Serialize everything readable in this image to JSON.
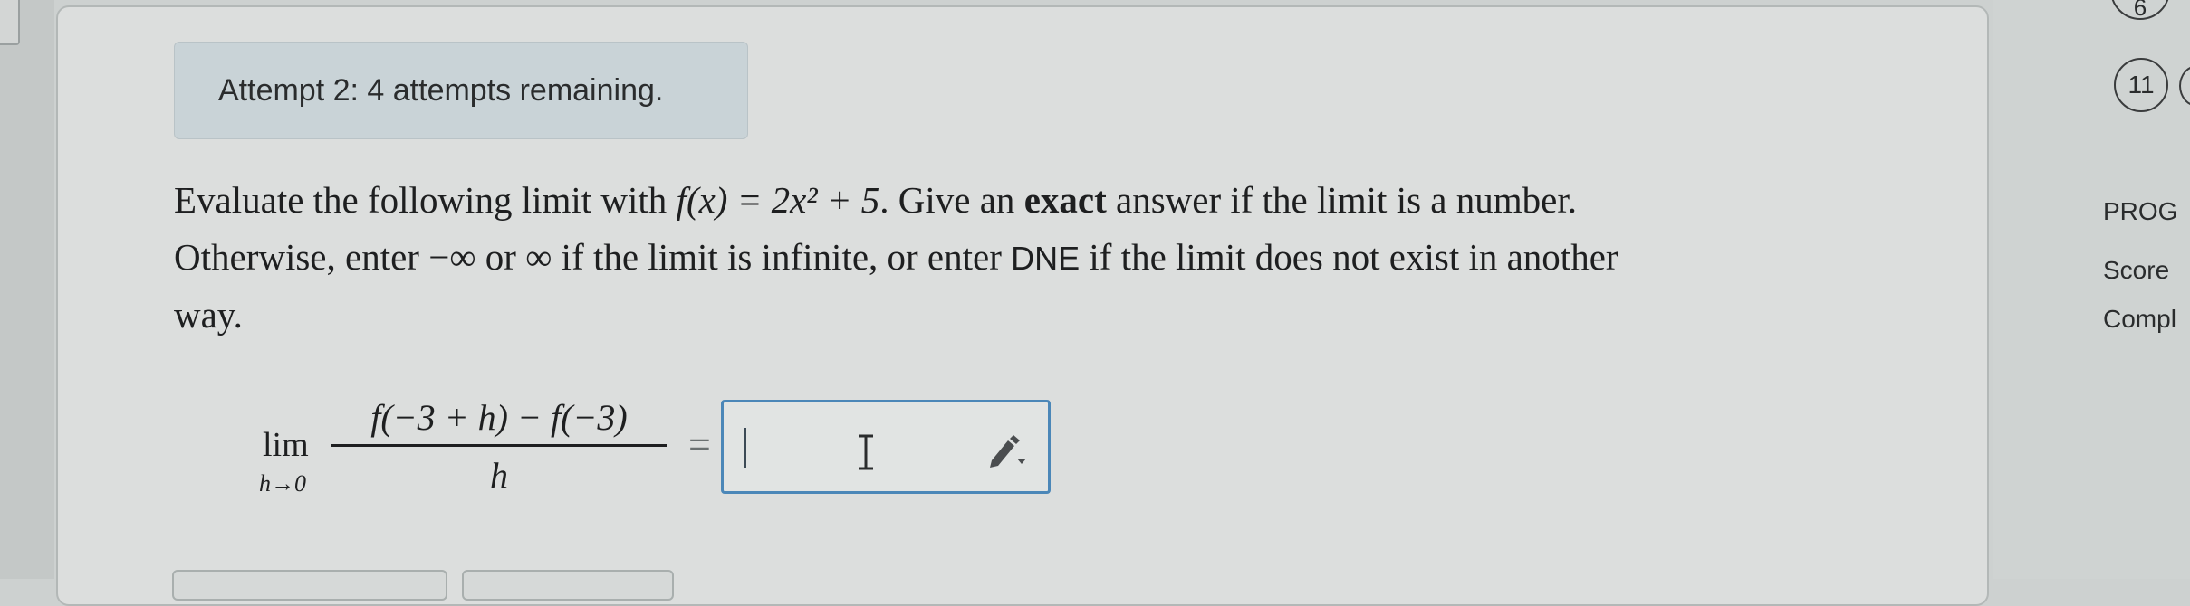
{
  "attempt_banner": {
    "text": "Attempt 2: 4 attempts remaining."
  },
  "question": {
    "part1": "Evaluate the following limit with ",
    "function_expr": "f(x) = 2x² + 5",
    "part2": ". Give an ",
    "exact_word": "exact",
    "part3": " answer if the limit is a number.",
    "part4": "Otherwise, enter −∞ or ∞ if the limit is infinite, or enter ",
    "dne_word": "DNE",
    "part5": " if the limit does not exist in another",
    "part6": "way."
  },
  "limit": {
    "lim_word": "lim",
    "subscript": "h→0",
    "numerator": "f(−3 + h) − f(−3)",
    "denominator": "h",
    "equals": "="
  },
  "answer": {
    "value": ""
  },
  "sidebar": {
    "top_circle": "6",
    "question_number": "11",
    "prog_label": "PROG",
    "score_label": "Score",
    "comp_label": "Compl"
  },
  "colors": {
    "card_background": "#dcdedd",
    "banner_background": "#c9d3d7",
    "input_border": "#4b87b8"
  }
}
